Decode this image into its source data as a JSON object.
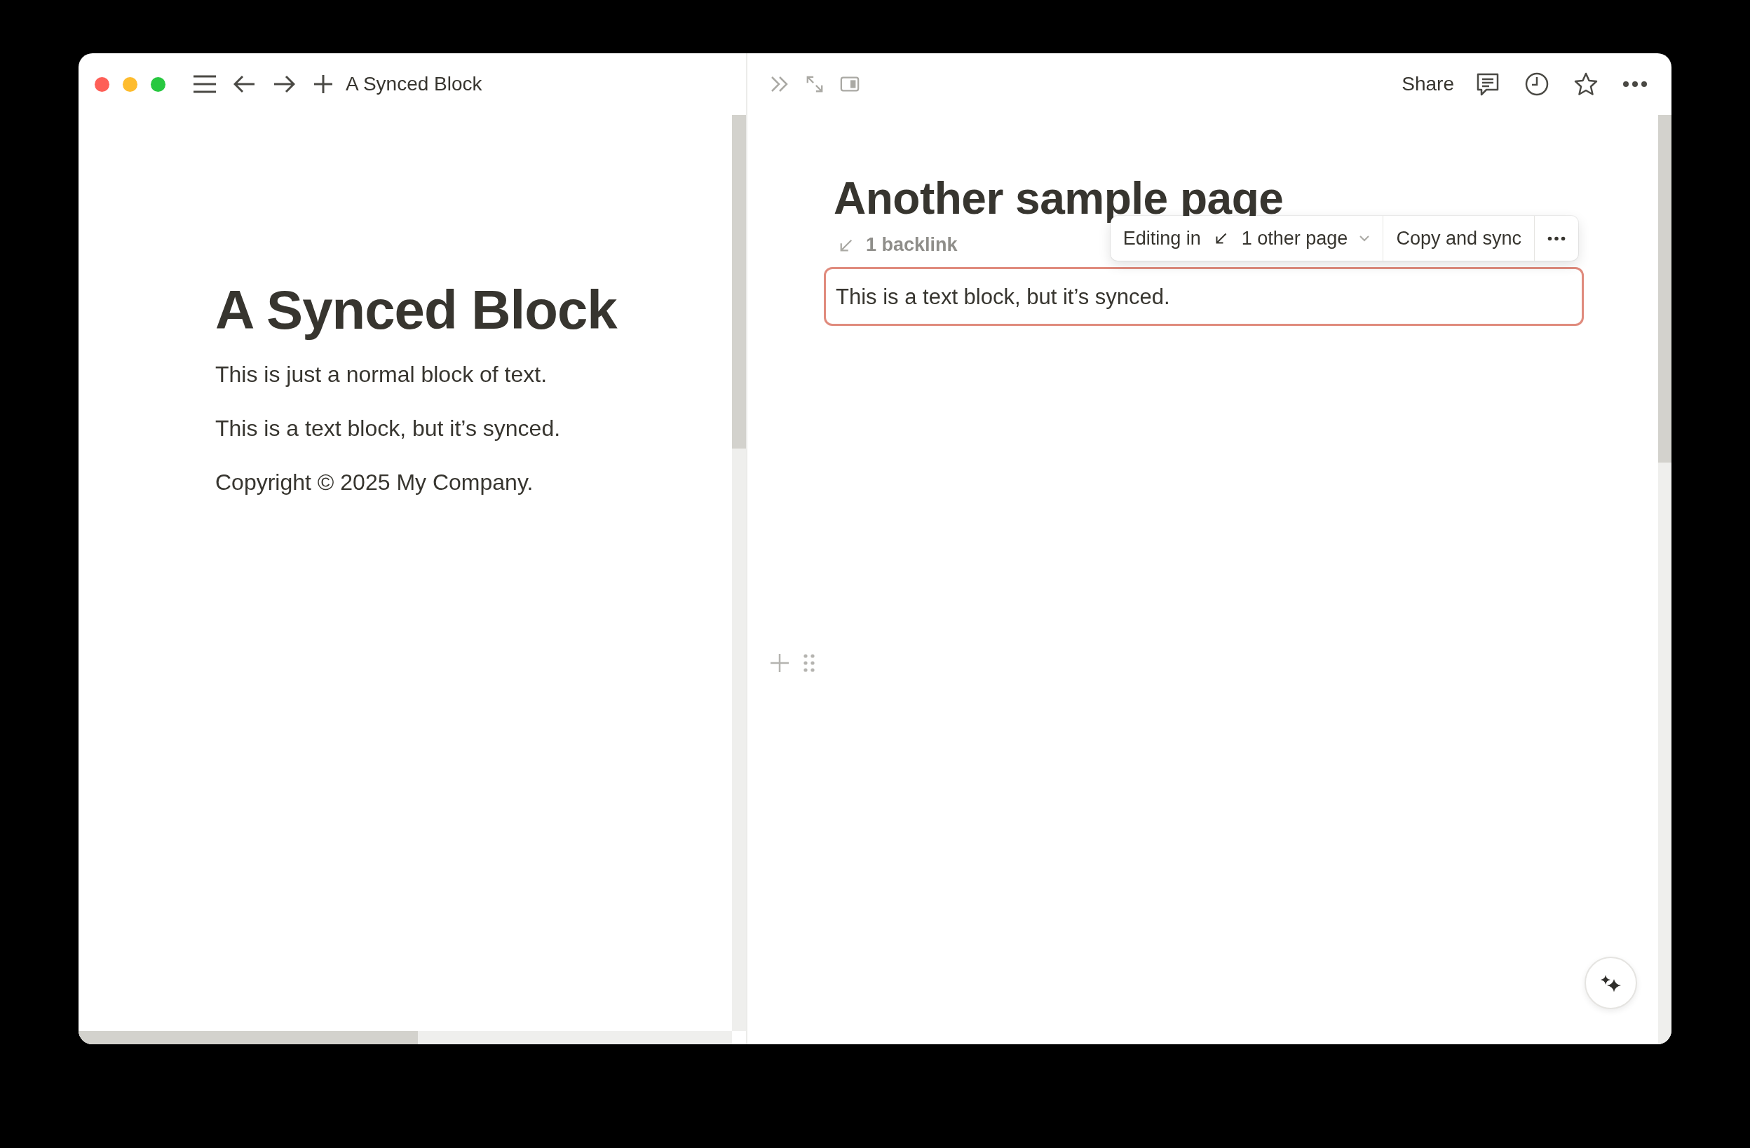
{
  "left_pane": {
    "tab_title": "A Synced Block",
    "page": {
      "title": "A Synced Block",
      "blocks": [
        {
          "text": "This is just a normal block of text."
        },
        {
          "text": "This is a text block, but it’s synced."
        },
        {
          "text": "Copyright © 2025 My Company."
        }
      ]
    }
  },
  "right_pane": {
    "toolbar": {
      "share": "Share"
    },
    "page": {
      "title": "Another sample page",
      "backlinks": "1 backlink",
      "synced_popover": {
        "editing_label": "Editing in",
        "pages": "1 other page",
        "copy_action": "Copy and sync"
      },
      "synced_block": {
        "text": "This is a text block, but it’s synced.",
        "selected": true
      }
    }
  }
}
